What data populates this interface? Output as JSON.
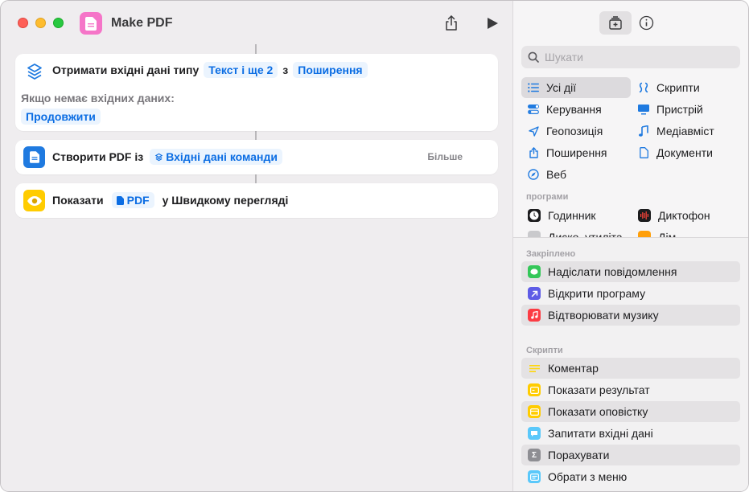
{
  "window": {
    "title": "Make PDF",
    "app_icon": "document-icon",
    "app_icon_color": "#f575c8"
  },
  "editor": {
    "action1": {
      "label": "Отримати вхідні дані типу",
      "token_types": "Текст і ще 2",
      "from_word": "з",
      "token_source": "Поширення",
      "no_input_label": "Якщо немає вхідних даних:",
      "no_input_token": "Продовжити",
      "icon": "stack-icon"
    },
    "action2": {
      "label": "Створити PDF із",
      "token_input": "Вхідні дані команди",
      "more": "Більше",
      "icon": "document-icon"
    },
    "action3": {
      "label": "Показати",
      "token_pdf": "PDF",
      "suffix": "у Швидкому перегляді",
      "icon": "eye-icon"
    }
  },
  "sidebar": {
    "search_placeholder": "Шукати",
    "categories": [
      {
        "label": "Усі дії",
        "icon": "list-icon",
        "selected": true
      },
      {
        "label": "Скрипти",
        "icon": "scripting-icon"
      },
      {
        "label": "Керування",
        "icon": "toggle-icon"
      },
      {
        "label": "Пристрій",
        "icon": "display-icon"
      },
      {
        "label": "Геопозиція",
        "icon": "location-icon"
      },
      {
        "label": "Медіавміст",
        "icon": "music-note-icon"
      },
      {
        "label": "Поширення",
        "icon": "share-icon"
      },
      {
        "label": "Документи",
        "icon": "document-icon"
      },
      {
        "label": "Веб",
        "icon": "compass-icon"
      }
    ],
    "apps_label": "програми",
    "apps": [
      {
        "label": "Годинник",
        "icon": "clock-icon"
      },
      {
        "label": "Диктофон",
        "icon": "voice-memos-icon"
      },
      {
        "label": "Диско. утиліта",
        "icon": "disk-utility-icon"
      },
      {
        "label": "Дім",
        "icon": "home-icon"
      }
    ],
    "pinned_label": "Закріплено",
    "pinned": [
      {
        "label": "Надіслати повідомлення",
        "icon": "messages-icon",
        "color": "#34c759"
      },
      {
        "label": "Відкрити програму",
        "icon": "arrow-icon",
        "color": "#5e5ce6"
      },
      {
        "label": "Відтворювати музику",
        "icon": "music-icon",
        "color": "#fc3c44"
      }
    ],
    "scripts_label": "Скрипти",
    "scripts": [
      {
        "label": "Коментар",
        "icon": "comment-icon",
        "color": "#ffd60a"
      },
      {
        "label": "Показати результат",
        "icon": "result-icon",
        "color": "#ffcc00"
      },
      {
        "label": "Показати оповістку",
        "icon": "alert-icon",
        "color": "#ffcc00"
      },
      {
        "label": "Запитати вхідні дані",
        "icon": "ask-icon",
        "color": "#5ac8fa"
      },
      {
        "label": "Порахувати",
        "icon": "sigma-icon",
        "color": "#8e8e93"
      },
      {
        "label": "Обрати з меню",
        "icon": "menu-icon",
        "color": "#5ac8fa"
      }
    ]
  }
}
